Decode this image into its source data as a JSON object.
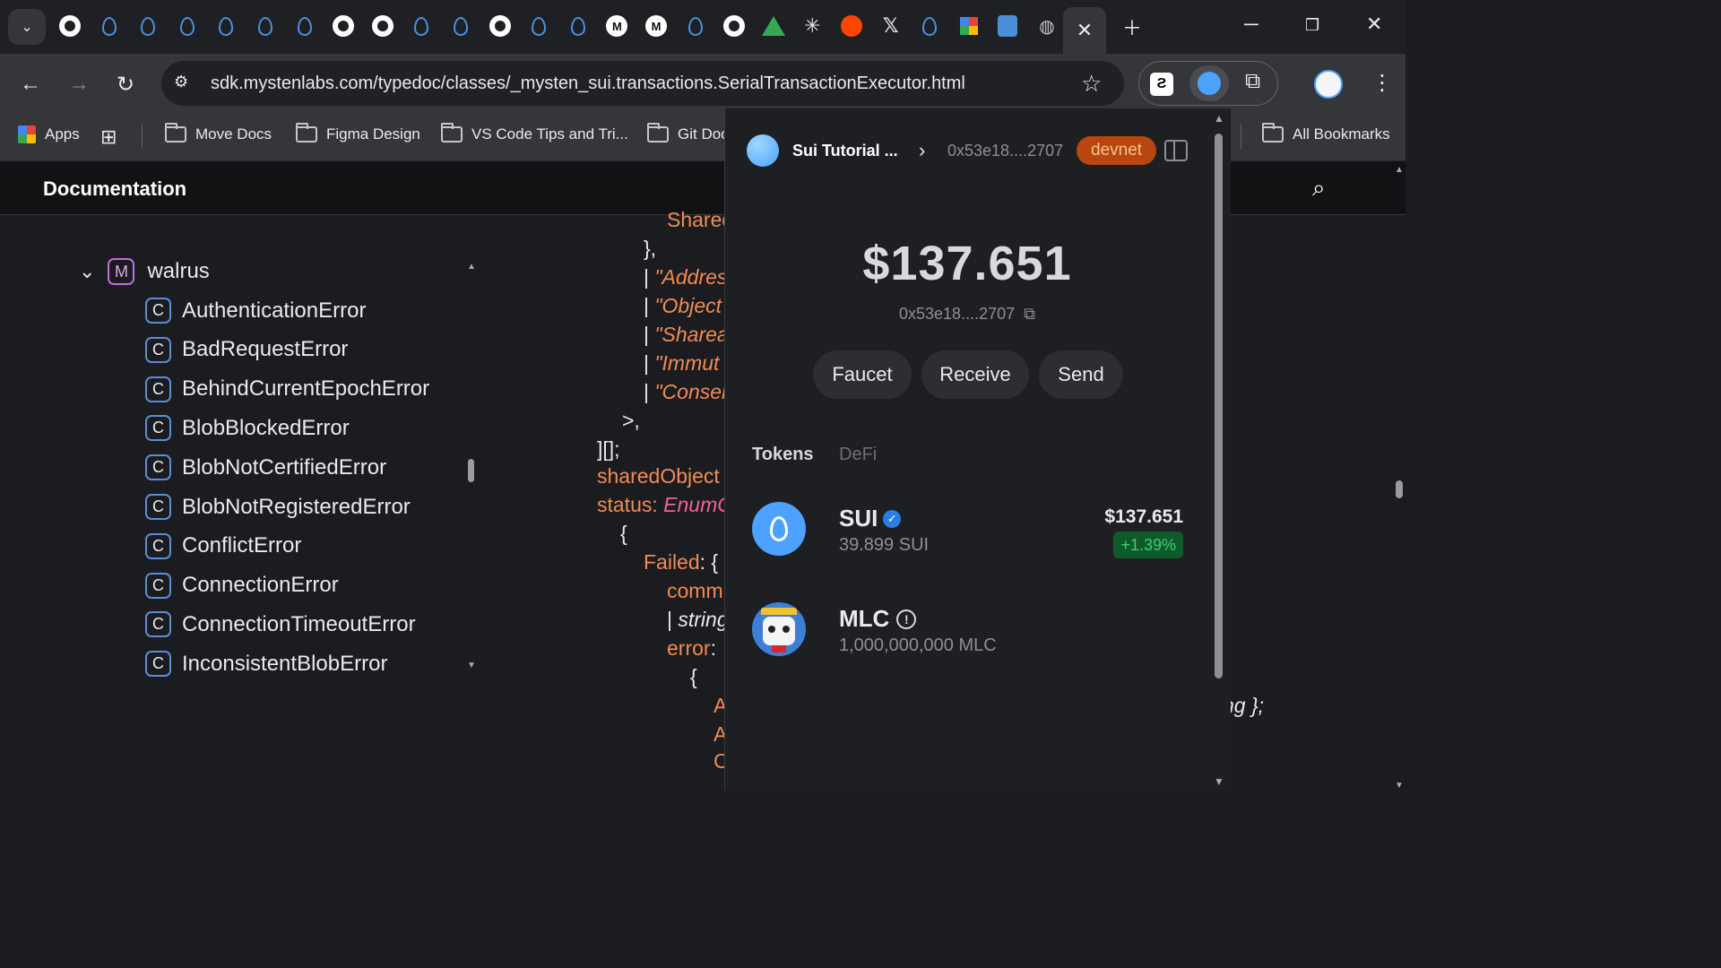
{
  "browser": {
    "url": "sdk.mystenlabs.com/typedoc/classes/_mysten_sui.transactions.SerialTransactionExecutor.html",
    "tab_icons": [
      "github-icon",
      "sui-drop-icon",
      "sui-drop-icon",
      "sui-drop-icon",
      "sui-drop-icon",
      "sui-drop-icon",
      "sui-drop-icon",
      "github-icon",
      "github-icon",
      "sui-drop-icon",
      "sui-drop-icon",
      "github-icon",
      "sui-drop-icon",
      "sui-drop-icon",
      "mysten-wallet-icon",
      "mysten-wallet-icon",
      "sui-drop-icon",
      "github-icon",
      "google-drive-icon",
      "claude-icon",
      "reddit-icon",
      "x-icon",
      "sui-drop-icon",
      "apps-grid-icon",
      "extension-page-icon",
      "globe-icon"
    ],
    "bookmarks": [
      "Apps",
      "Move Docs",
      "Figma Design",
      "VS Code Tips and Tri...",
      "Git Doc",
      "All Bookmarks"
    ]
  },
  "docs": {
    "header_title": "Documentation",
    "module": {
      "badge": "M",
      "name": "walrus"
    },
    "classes": [
      "AuthenticationError",
      "BadRequestError",
      "BehindCurrentEpochError",
      "BlobBlockedError",
      "BlobNotCertifiedError",
      "BlobNotRegisteredError",
      "ConflictError",
      "ConnectionError",
      "ConnectionTimeoutError",
      "InconsistentBlobError"
    ],
    "class_badge": "C"
  },
  "code": {
    "line1": "Shared",
    "line2": "},",
    "line3a": "| ",
    "line3b": "\"Addres",
    "line4b": "\"Object",
    "line5b": "\"Sharea",
    "line6b": "\"Immut",
    "line7b": "\"Conser",
    "line8": ">,",
    "line9": "][];",
    "line10": "sharedObject",
    "line11a": "status: ",
    "line11b": "EnumC",
    "line12": "{",
    "line13a": "Failed",
    "line13b": ": {",
    "line14": "comm",
    "line15a": "| ",
    "line15b": "string",
    "line16a": "error",
    "line16b": ":",
    "line17": "{",
    "line18": "A",
    "line19": "A",
    "line20": "C",
    "right_fragment": "ng };"
  },
  "wallet": {
    "account_name": "Sui Tutorial ...",
    "address_short": "0x53e18....2707",
    "network": "devnet",
    "balance": "$137.651",
    "balance_address": "0x53e18....2707",
    "buttons": {
      "faucet": "Faucet",
      "receive": "Receive",
      "send": "Send"
    },
    "tabs": {
      "tokens": "Tokens",
      "defi": "DeFi"
    },
    "tokens": [
      {
        "symbol": "SUI",
        "amount": "39.899 SUI",
        "value": "$137.651",
        "change": "+1.39%",
        "verified": true
      },
      {
        "symbol": "MLC",
        "amount": "1,000,000,000 MLC",
        "warning": true
      }
    ],
    "colors": {
      "network_badge": "#b8470f",
      "change_badge": "#0f5a2b",
      "accent": "#4da2ff"
    }
  }
}
